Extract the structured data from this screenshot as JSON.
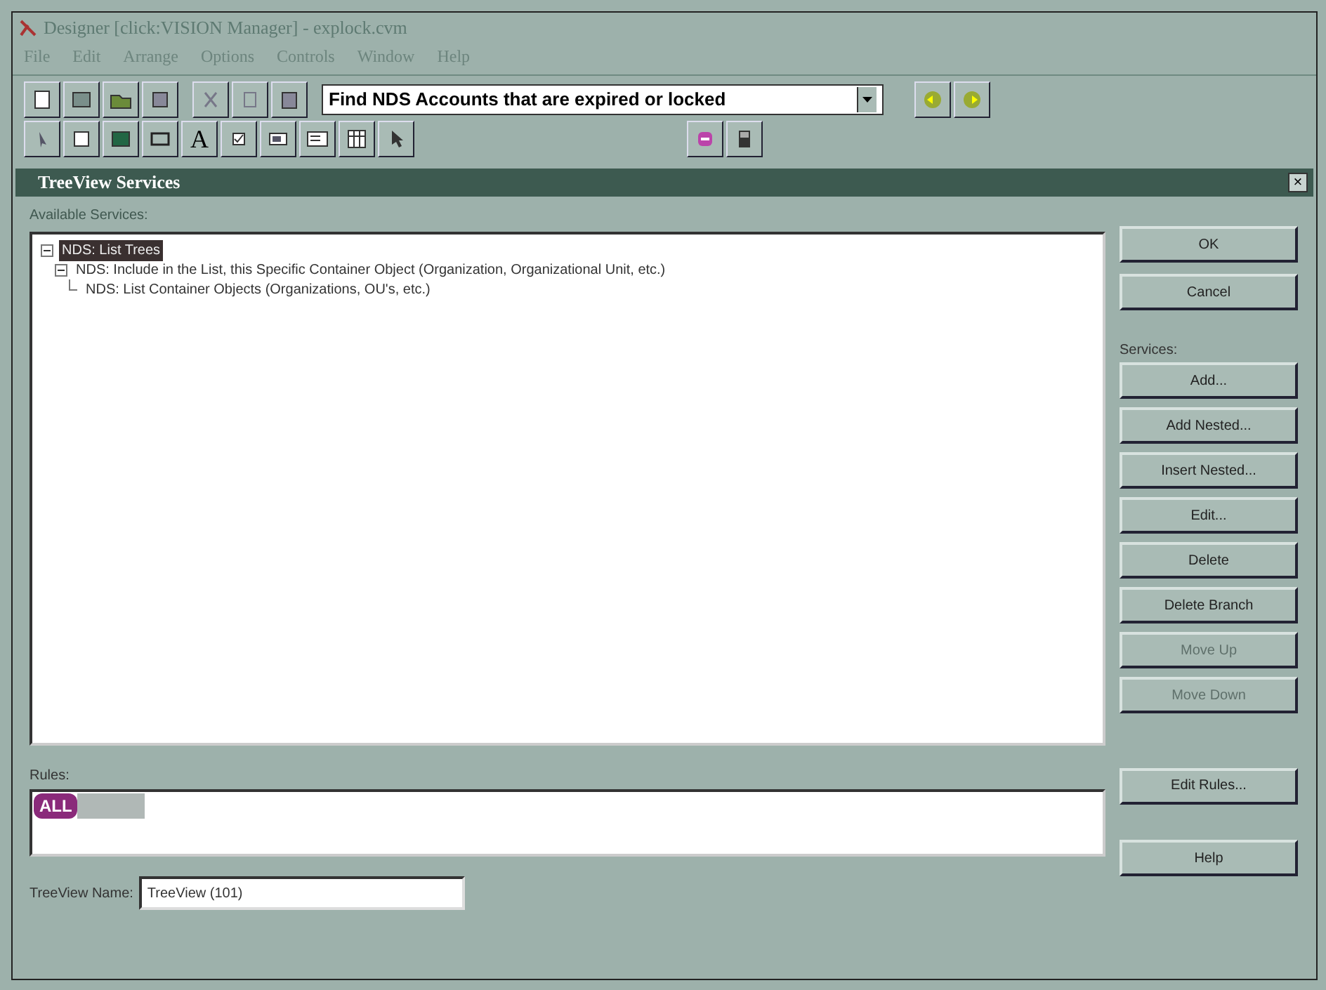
{
  "window": {
    "title": "Designer [click:VISION Manager] - explock.cvm"
  },
  "menu": [
    "File",
    "Edit",
    "Arrange",
    "Options",
    "Controls",
    "Window",
    "Help"
  ],
  "toolbar": {
    "query_dropdown": "Find NDS Accounts that are expired or locked",
    "text_tool": "A"
  },
  "dialog": {
    "title": "TreeView Services",
    "close": "×",
    "services_label": "Available Services:",
    "tree": [
      {
        "label": "NDS: List Trees",
        "selected": true,
        "expanded": true,
        "children": [
          {
            "label": "NDS: Include in the List, this Specific Container Object (Organization, Organizational Unit, etc.)",
            "selected": false,
            "expanded": true,
            "children": [
              {
                "label": "NDS: List Container Objects (Organizations, OU's, etc.)",
                "selected": false
              }
            ]
          }
        ]
      }
    ],
    "top_buttons": [
      {
        "label": "OK",
        "disabled": false
      },
      {
        "label": "Cancel",
        "disabled": false
      }
    ],
    "services_group_label": "Services:",
    "service_buttons": [
      {
        "label": "Add...",
        "disabled": false
      },
      {
        "label": "Add Nested...",
        "disabled": false
      },
      {
        "label": "Insert Nested...",
        "disabled": false
      },
      {
        "label": "Edit...",
        "disabled": false
      },
      {
        "label": "Delete",
        "disabled": false
      },
      {
        "label": "Delete Branch",
        "disabled": false
      },
      {
        "label": "Move Up",
        "disabled": true
      },
      {
        "label": "Move Down",
        "disabled": true
      }
    ],
    "rules_label": "Rules:",
    "rules": [
      {
        "label": "ALL",
        "color": "#8a2a7a"
      }
    ],
    "edit_rules_button": "Edit Rules...",
    "name_label": "TreeView Name:",
    "name_value": "TreeView (101)",
    "help_button": "Help"
  }
}
